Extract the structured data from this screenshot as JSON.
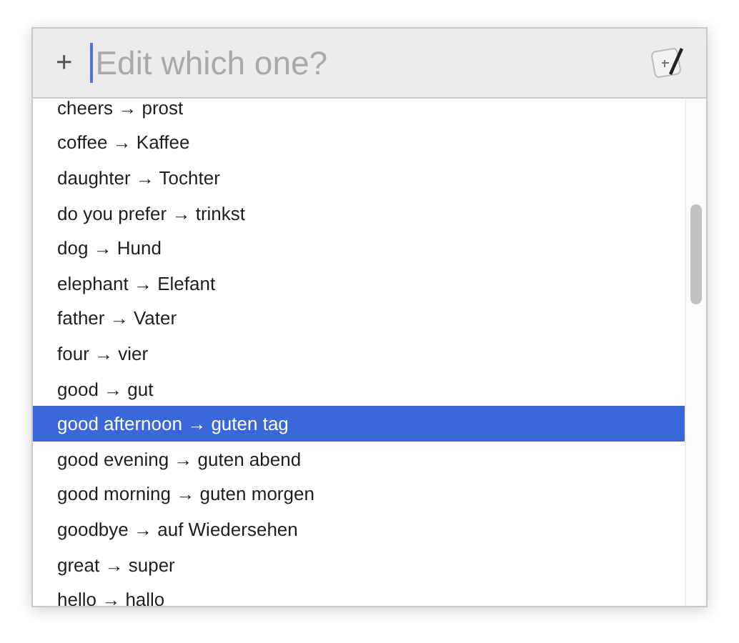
{
  "search": {
    "add_button": "+",
    "placeholder": "Edit which one?"
  },
  "items": [
    {
      "label": "cheers → prost",
      "selected": false
    },
    {
      "label": "coffee → Kaffee",
      "selected": false
    },
    {
      "label": "daughter → Tochter",
      "selected": false
    },
    {
      "label": "do you prefer → trinkst",
      "selected": false
    },
    {
      "label": "dog → Hund",
      "selected": false
    },
    {
      "label": "elephant → Elefant",
      "selected": false
    },
    {
      "label": "father → Vater",
      "selected": false
    },
    {
      "label": "four → vier",
      "selected": false
    },
    {
      "label": "good → gut",
      "selected": false
    },
    {
      "label": "good afternoon → guten tag",
      "selected": true
    },
    {
      "label": "good evening → guten abend",
      "selected": false
    },
    {
      "label": "good morning → guten morgen",
      "selected": false
    },
    {
      "label": "goodbye → auf Wiedersehen",
      "selected": false
    },
    {
      "label": "great → super",
      "selected": false
    },
    {
      "label": "hello → hallo",
      "selected": false
    }
  ]
}
